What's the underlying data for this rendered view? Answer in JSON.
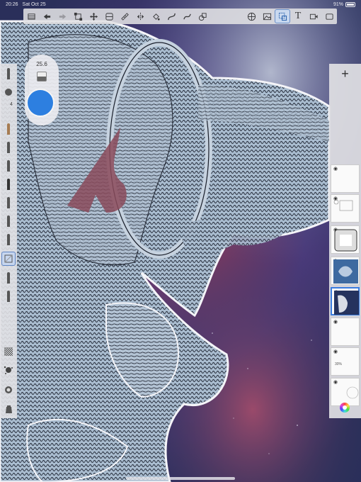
{
  "status_bar": {
    "time": "20:26",
    "date": "Sat Oct 25",
    "battery": "91%"
  },
  "toolbar": {
    "icons": [
      "gallery-icon",
      "undo-icon",
      "redo-icon",
      "transform-icon",
      "symmetry-icon",
      "ruler-icon",
      "perspective-icon",
      "fill-icon",
      "selection-icon",
      "curve-icon",
      "stroke-icon",
      "shape-icon",
      "grid-icon",
      "image-icon",
      "reference-icon",
      "text-icon",
      "video-icon",
      "fullscreen-icon"
    ],
    "text_tool_label": "T"
  },
  "brush": {
    "size": "25.6",
    "color": "#2d7fe0"
  },
  "left_tools": {
    "size_label": "4"
  },
  "layers": {
    "add_label": "+",
    "opacity_label": "30%",
    "selected_index": 4
  },
  "colors": {
    "accent": "#3a7de0",
    "panel_bg": "#e1e1e4",
    "background_tint": "#2a2f5a"
  }
}
